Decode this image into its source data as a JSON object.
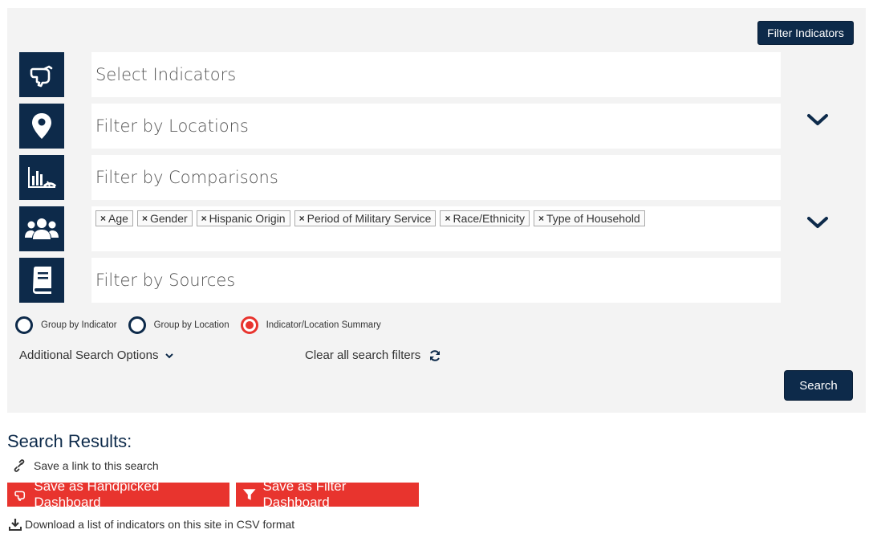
{
  "toolbar": {
    "filter_indicators_label": "Filter Indicators"
  },
  "rows": {
    "indicators": {
      "label": "Select Indicators",
      "icon": "hand-pointer-icon"
    },
    "locations": {
      "label": "Filter by Locations",
      "icon": "map-marker-icon"
    },
    "comparisons": {
      "label": "Filter by Comparisons",
      "icon": "chart-gauge-icon"
    },
    "demographics": {
      "icon": "users-icon",
      "tags": [
        "Age",
        "Gender",
        "Hispanic Origin",
        "Period of Military Service",
        "Race/Ethnicity",
        "Type of Household"
      ]
    },
    "sources": {
      "label": "Filter by Sources",
      "icon": "book-icon"
    }
  },
  "grouping": {
    "options": [
      {
        "label": "Group by Indicator",
        "selected": false
      },
      {
        "label": "Group by Location",
        "selected": false
      },
      {
        "label": "Indicator/Location Summary",
        "selected": true
      }
    ]
  },
  "options": {
    "additional_label": "Additional Search Options",
    "clear_label": "Clear all search filters"
  },
  "search_label": "Search",
  "results": {
    "title": "Search Results:",
    "save_link_label": "Save a link to this search",
    "handpicked_label": "Save as Handpicked Dashboard",
    "filter_dashboard_label": "Save as Filter Dashboard",
    "download_label": "Download a list of indicators on this site in CSV format"
  },
  "colors": {
    "navy": "#0d2a4a",
    "accent_red": "#e8342e",
    "panel_bg": "#f3f3f3"
  }
}
